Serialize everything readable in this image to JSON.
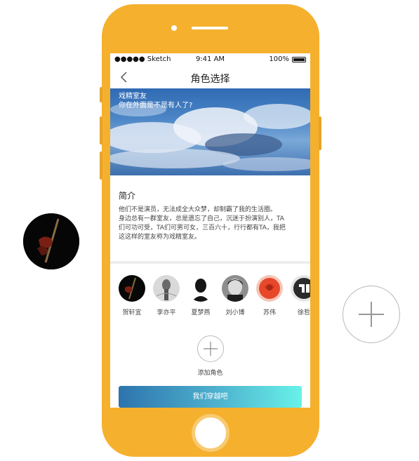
{
  "status_bar": {
    "carrier": "●●●●● Sketch",
    "time": "9:41 AM",
    "battery": "100%"
  },
  "nav": {
    "title": "角色选择"
  },
  "banner": {
    "line1": "戏精室友",
    "line2": "你在外面是不是有人了?"
  },
  "intro": {
    "title": "简介",
    "body": "他们不是演员，无法成全大众梦，却制霸了我的生活圈。\n身边总有一群室友，总是遗忘了自己，沉迷于扮演别人，TA\n们可功可受，TA们可男可女，三百六十，行行都有TA，我把\n这这样的室友称为戏精室友。"
  },
  "characters": [
    {
      "name": "贺轩宜",
      "icon": "guitar-avatar"
    },
    {
      "name": "李亦平",
      "icon": "mannequin-avatar"
    },
    {
      "name": "夏梦燕",
      "icon": "silhouette-avatar"
    },
    {
      "name": "刘小博",
      "icon": "portrait-avatar"
    },
    {
      "name": "苏伟",
      "icon": "rose-avatar"
    },
    {
      "name": "徐哲",
      "icon": "logo-avatar"
    }
  ],
  "add_role": {
    "label": "添加角色"
  },
  "cta": {
    "label": "我们穿越吧"
  },
  "colors": {
    "phone": "#f5b02e",
    "cta_start": "#2d74ad",
    "cta_end": "#68f2e8"
  }
}
